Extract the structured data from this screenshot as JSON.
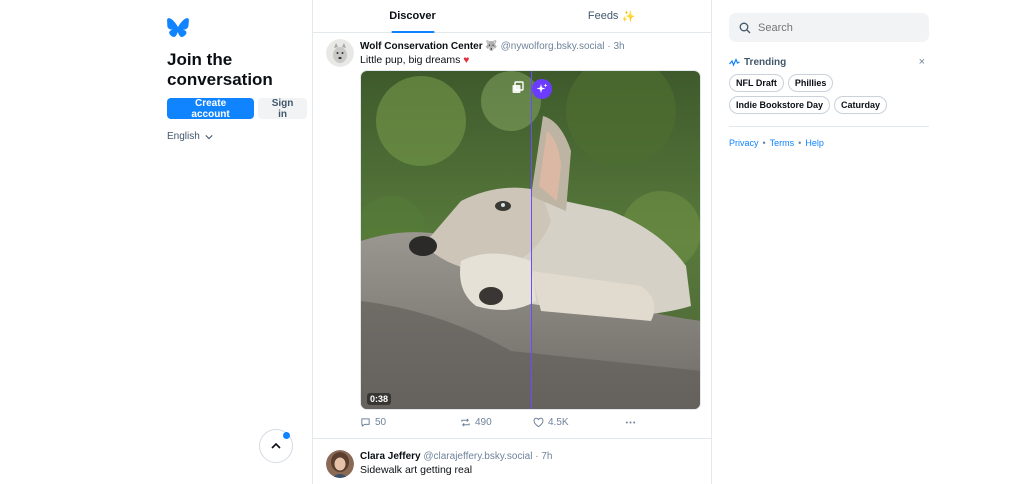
{
  "left": {
    "headline": "Join the conversation",
    "create_account": "Create account",
    "sign_in": "Sign in",
    "language": "English"
  },
  "tabs": [
    {
      "label": "Discover",
      "active": true
    },
    {
      "label": "Feeds",
      "emoji": "✨",
      "active": false
    }
  ],
  "posts": [
    {
      "author": "Wolf Conservation Center",
      "author_emoji": "🐺",
      "handle": "@nywolforg.bsky.social",
      "time": "3h",
      "text": "Little pup, big dreams",
      "text_emoji": "♥",
      "video_duration": "0:38",
      "replies": "50",
      "reposts": "490",
      "likes": "4.5K"
    },
    {
      "author": "Clara Jeffery",
      "handle": "@clarajeffery.bsky.social",
      "time": "7h",
      "text": "Sidewalk art getting real"
    }
  ],
  "right": {
    "search_placeholder": "Search",
    "trending_title": "Trending",
    "trending": [
      "NFL Draft",
      "Phillies",
      "Indie Bookstore Day",
      "Caturday"
    ],
    "links": [
      "Privacy",
      "Terms",
      "Help"
    ]
  },
  "colors": {
    "accent": "#1083fe",
    "ai_button": "#6b3cff",
    "heart": "#e02b3b"
  }
}
